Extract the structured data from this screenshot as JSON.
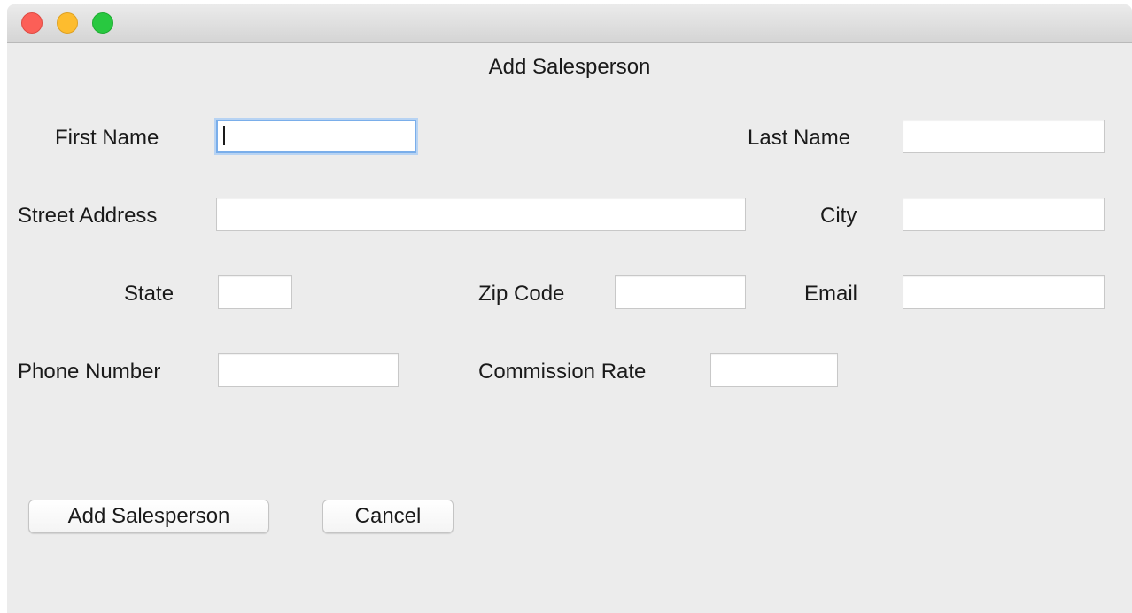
{
  "window": {
    "title": "Add Salesperson"
  },
  "form": {
    "first_name": {
      "label": "First Name",
      "value": "",
      "placeholder": ""
    },
    "last_name": {
      "label": "Last Name",
      "value": "",
      "placeholder": ""
    },
    "street_address": {
      "label": "Street Address",
      "value": "",
      "placeholder": ""
    },
    "city": {
      "label": "City",
      "value": "",
      "placeholder": ""
    },
    "state": {
      "label": "State",
      "value": "",
      "placeholder": ""
    },
    "zip_code": {
      "label": "Zip Code",
      "value": "",
      "placeholder": ""
    },
    "email": {
      "label": "Email",
      "value": "",
      "placeholder": ""
    },
    "phone_number": {
      "label": "Phone Number",
      "value": "",
      "placeholder": ""
    },
    "commission_rate": {
      "label": "Commission Rate",
      "value": "",
      "placeholder": ""
    }
  },
  "buttons": {
    "add_label": "Add Salesperson",
    "cancel_label": "Cancel"
  },
  "colors": {
    "window_bg": "#ececec",
    "focus_ring": "#7aaeea",
    "close": "#fc5f57",
    "minimize": "#fdbc2e",
    "maximize": "#28c840"
  },
  "icons": [
    "close-window-icon",
    "minimize-window-icon",
    "maximize-window-icon"
  ]
}
